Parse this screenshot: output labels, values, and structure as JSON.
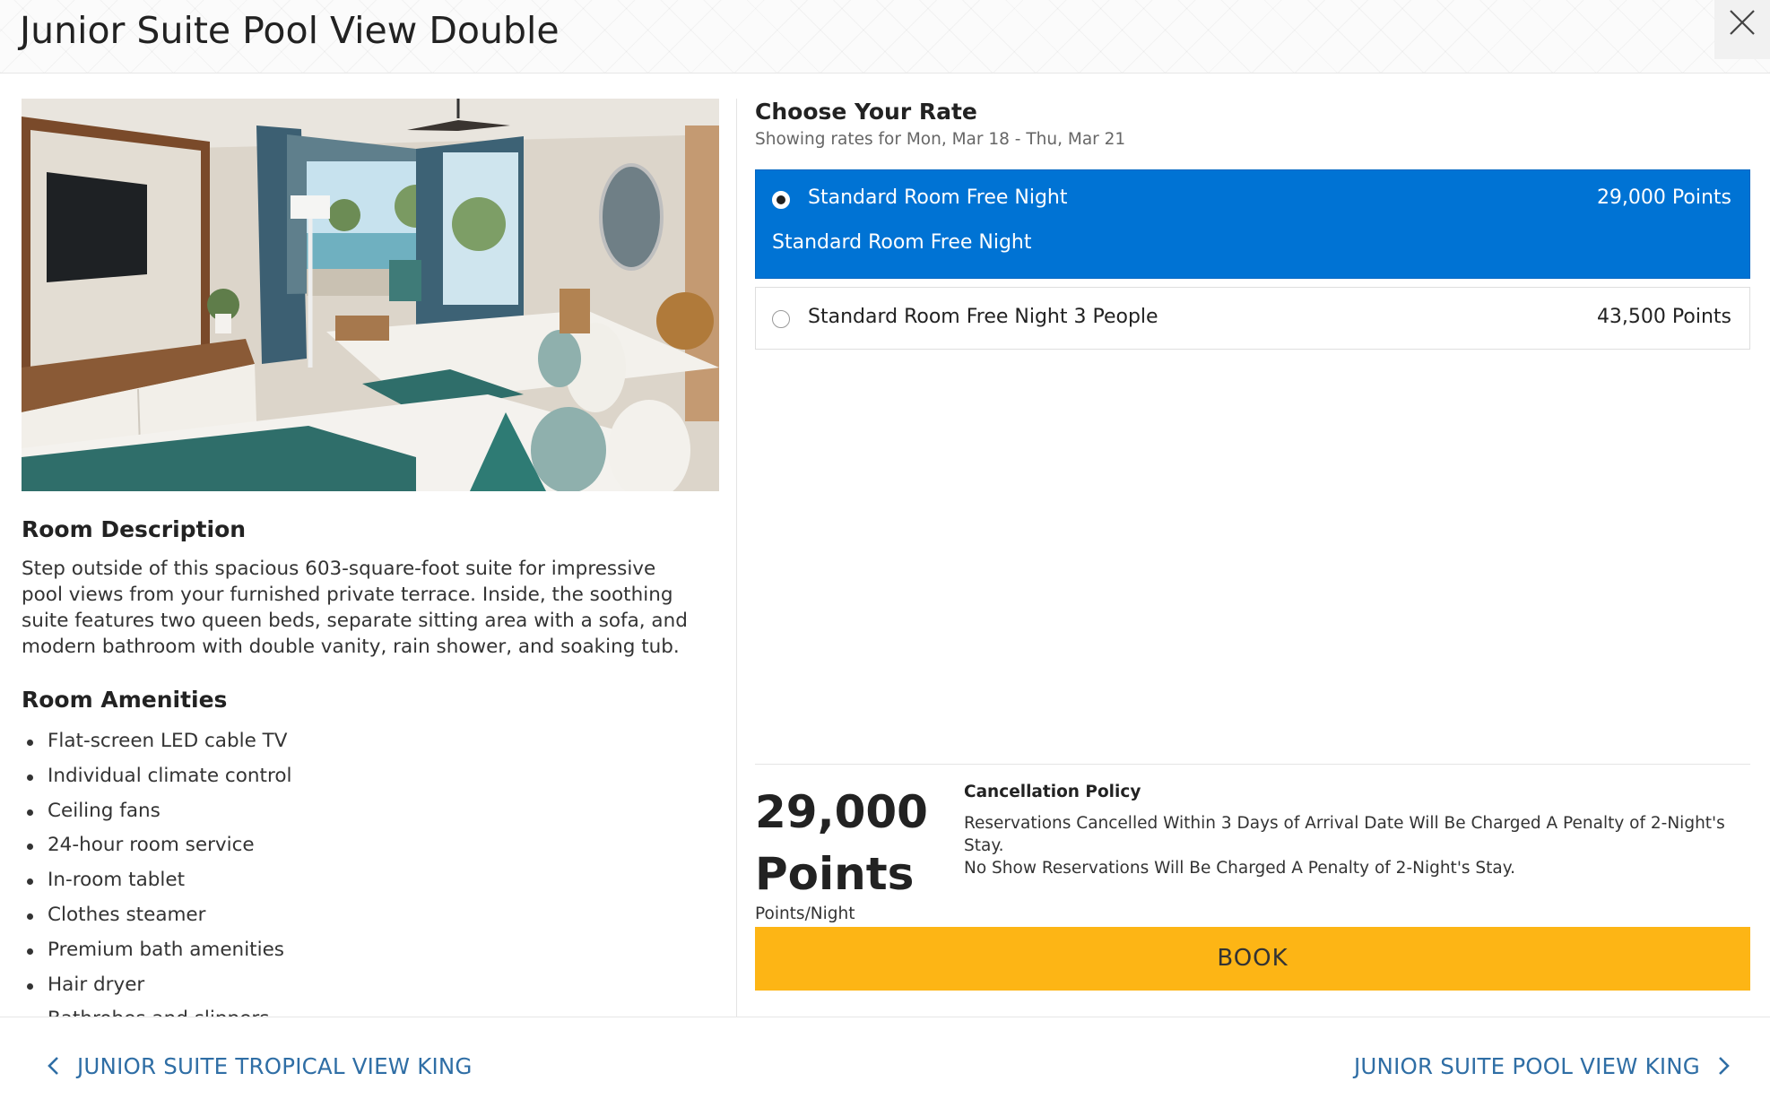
{
  "header": {
    "title": "Junior Suite Pool View Double"
  },
  "room": {
    "photo_alt": "Junior suite with two queen beds and pool view terrace",
    "description_heading": "Room Description",
    "description": "Step outside of this spacious 603-square-foot suite for impressive pool views from your furnished private terrace. Inside, the soothing suite features two queen beds, separate sitting area with a sofa, and modern bathroom with double vanity, rain shower, and soaking tub.",
    "amenities_heading": "Room Amenities",
    "amenities": [
      "Flat-screen LED cable TV",
      "Individual climate control",
      "Ceiling fans",
      "24-hour room service",
      "In-room tablet",
      "Clothes steamer",
      "Premium bath amenities",
      "Hair dryer",
      "Bathrobes and slippers"
    ]
  },
  "rates": {
    "heading": "Choose Your Rate",
    "subheading": "Showing rates for Mon, Mar 18 - Thu, Mar 21",
    "options": [
      {
        "name": "Standard Room Free Night",
        "points": "29,000 Points",
        "description": "Standard Room Free Night",
        "selected": true
      },
      {
        "name": "Standard Room Free Night 3 People",
        "points": "43,500 Points",
        "selected": false
      }
    ]
  },
  "summary": {
    "points_value": "29,000",
    "points_unit": "Points",
    "per_night": "Points/Night",
    "cancellation_title": "Cancellation Policy",
    "cancellation_lines": [
      "Reservations Cancelled Within 3 Days of Arrival Date Will Be Charged A Penalty of 2-Night's Stay.",
      "No Show Reservations Will Be Charged A Penalty of 2-Night's Stay."
    ],
    "book_label": "BOOK"
  },
  "footer": {
    "prev_label": "JUNIOR SUITE TROPICAL VIEW KING",
    "next_label": "JUNIOR SUITE POOL VIEW KING"
  },
  "colors": {
    "selected_rate_bg": "#0073d4",
    "book_button_bg": "#fdb515",
    "nav_link": "#2f6ea5"
  },
  "icons": {
    "close": "close-icon",
    "prev": "chevron-left-icon",
    "next": "chevron-right-icon"
  }
}
